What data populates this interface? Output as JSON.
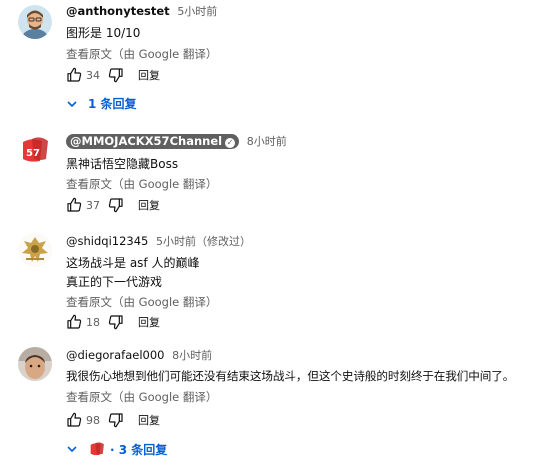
{
  "comments": [
    {
      "author": "@anthonytestet",
      "time": "5小时前",
      "lines": [
        "图形是 10/10"
      ],
      "translate": "查看原文（由 Google 翻译）",
      "likes": "34",
      "reply_label": "回复",
      "replies_label": "1 条回复"
    },
    {
      "author": "@MMOJACKX57Channel",
      "verified_icon": "check-icon",
      "time": "8小时前",
      "lines": [
        "黑神话悟空隐藏Boss"
      ],
      "translate": "查看原文（由 Google 翻译）",
      "likes": "37",
      "reply_label": "回复"
    },
    {
      "author": "@shidqi12345",
      "time": "5小时前（修改过）",
      "lines": [
        "这场战斗是 asf 人的巅峰",
        "真正的下一代游戏"
      ],
      "translate": "查看原文（由 Google 翻译）",
      "likes": "18",
      "reply_label": "回复"
    },
    {
      "author": "@diegorafael000",
      "time": "8小时前",
      "lines": [
        "我很伤心地想到他们可能还没有结束这场战斗，但这个史诗般的时刻终于在我们中间了。"
      ],
      "translate": "查看原文（由 Google 翻译）",
      "likes": "98",
      "reply_label": "回复",
      "replies_label": "· 3 条回复"
    }
  ],
  "colors": {
    "link": "#065fd4",
    "secondary": "#606060",
    "chip": "#606060"
  }
}
